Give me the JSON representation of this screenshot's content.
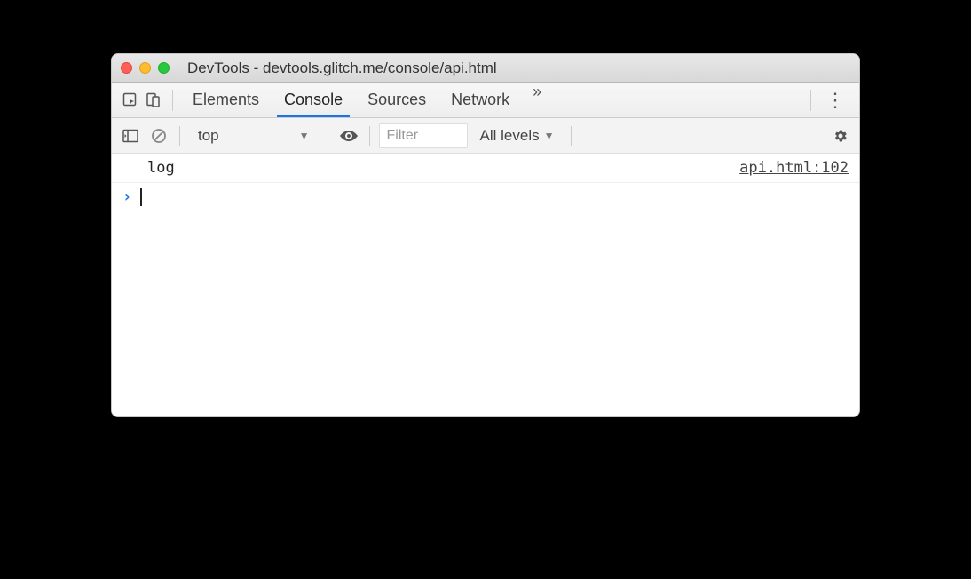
{
  "window": {
    "title": "DevTools - devtools.glitch.me/console/api.html"
  },
  "tabs": {
    "elements": "Elements",
    "console": "Console",
    "sources": "Sources",
    "network": "Network",
    "more": "»"
  },
  "subtoolbar": {
    "context": "top",
    "filter_placeholder": "Filter",
    "levels": "All levels"
  },
  "console": {
    "rows": [
      {
        "message": "log",
        "source": "api.html:102"
      }
    ]
  },
  "icons": {
    "chevron_down": "▼",
    "prompt": "›"
  }
}
